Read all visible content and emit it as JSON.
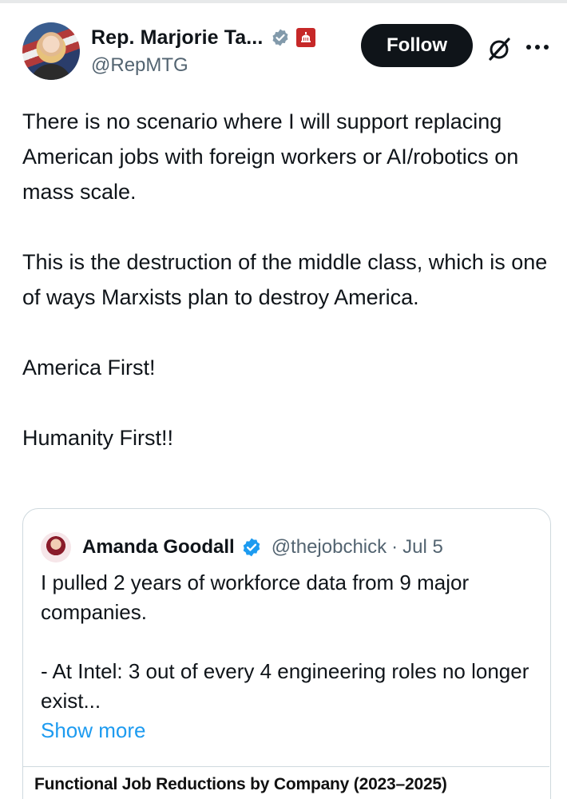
{
  "author": {
    "display_name": "Rep. Marjorie Ta...",
    "handle": "@RepMTG",
    "badge_color": "#829aab",
    "gov_badge_color": "#c62828"
  },
  "actions": {
    "follow_label": "Follow",
    "grok_icon": "grok-icon",
    "more_icon": "more-icon"
  },
  "tweet": {
    "paragraphs": [
      "There is no scenario where I will support replacing American jobs with foreign workers or AI/robotics on mass scale.",
      "This is the destruction of the middle class, which is one of ways Marxists plan to destroy America.",
      "America First!",
      "Humanity First!!"
    ]
  },
  "quote": {
    "display_name": "Amanda Goodall",
    "handle": "@thejobchick",
    "separator": "·",
    "date": "Jul 5",
    "verified_color": "#1d9bf0",
    "paragraphs": [
      "I pulled 2 years of workforce data from 9 major companies.",
      "- At Intel: 3 out of every 4 engineering roles no longer exist..."
    ],
    "show_more": "Show more",
    "image_title": "Functional Job Reductions by Company (2023–2025)"
  },
  "colors": {
    "text": "#0f1419",
    "secondary": "#536471",
    "link": "#1d9bf0",
    "border": "#cfd9de"
  }
}
